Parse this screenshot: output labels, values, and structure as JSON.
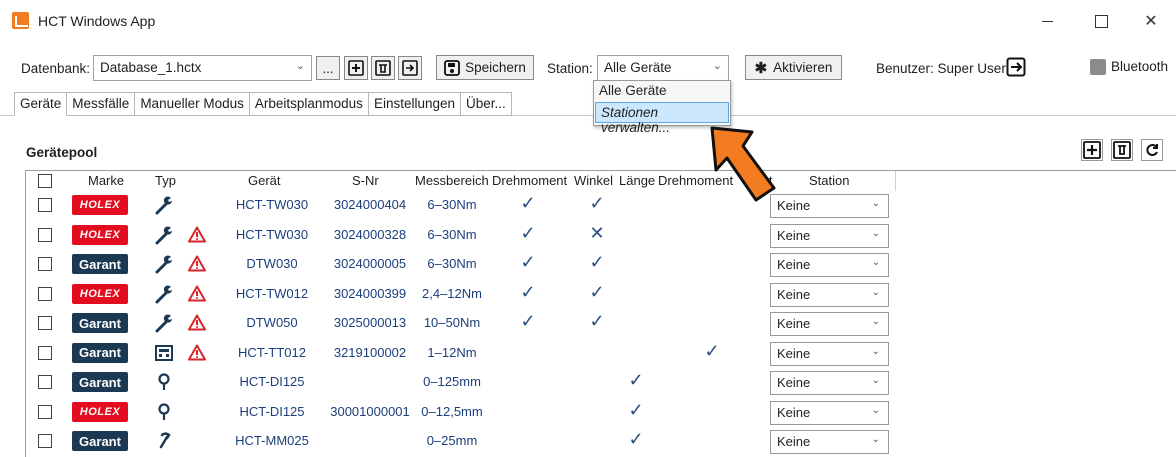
{
  "window": {
    "title": "HCT Windows App"
  },
  "toolbar": {
    "database_label": "Datenbank:",
    "database_value": "Database_1.hctx",
    "browse_label": "...",
    "save_label": "Speichern",
    "station_label": "Station:",
    "station_value": "Alle Geräte",
    "activate_label": "Aktivieren",
    "user_label": "Benutzer: Super User",
    "bluetooth_label": "Bluetooth"
  },
  "station_dropdown": {
    "options": [
      "Alle Geräte",
      "Stationen verwalten..."
    ],
    "highlighted": "Stationen verwalten..."
  },
  "tabs": [
    "Geräte",
    "Messfälle",
    "Manueller Modus",
    "Arbeitsplanmodus",
    "Einstellungen",
    "Über..."
  ],
  "pool": {
    "title": "Gerätepool"
  },
  "table": {
    "columns": [
      "Marke",
      "Typ",
      "Gerät",
      "S-Nr",
      "Messbereich",
      "Drehmoment",
      "Winkel",
      "Länge",
      "Drehmoment",
      "Station"
    ],
    "header_hidden_suffix": "...t",
    "rows": [
      {
        "brand": "HOLEX",
        "type_icon": "torque-wrench-icon",
        "warning": false,
        "device": "HCT-TW030",
        "serial": "3024000404",
        "range": "6–30Nm",
        "drehmoment": "check",
        "winkel": "check",
        "laenge": "",
        "drehmoment2": "",
        "station": "Keine"
      },
      {
        "brand": "HOLEX",
        "type_icon": "torque-wrench-icon",
        "warning": true,
        "device": "HCT-TW030",
        "serial": "3024000328",
        "range": "6–30Nm",
        "drehmoment": "check",
        "winkel": "cross",
        "laenge": "",
        "drehmoment2": "",
        "station": "Keine"
      },
      {
        "brand": "Garant",
        "type_icon": "torque-wrench-icon",
        "warning": true,
        "device": "DTW030",
        "serial": "3024000005",
        "range": "6–30Nm",
        "drehmoment": "check",
        "winkel": "check",
        "laenge": "",
        "drehmoment2": "",
        "station": "Keine"
      },
      {
        "brand": "HOLEX",
        "type_icon": "torque-wrench-icon",
        "warning": true,
        "device": "HCT-TW012",
        "serial": "3024000399",
        "range": "2,4–12Nm",
        "drehmoment": "check",
        "winkel": "check",
        "laenge": "",
        "drehmoment2": "",
        "station": "Keine"
      },
      {
        "brand": "Garant",
        "type_icon": "torque-wrench-icon",
        "warning": true,
        "device": "DTW050",
        "serial": "3025000013",
        "range": "10–50Nm",
        "drehmoment": "check",
        "winkel": "check",
        "laenge": "",
        "drehmoment2": "",
        "station": "Keine"
      },
      {
        "brand": "Garant",
        "type_icon": "torque-tester-icon",
        "warning": true,
        "device": "HCT-TT012",
        "serial": "3219100002",
        "range": "1–12Nm",
        "drehmoment": "",
        "winkel": "",
        "laenge": "",
        "drehmoment2": "check",
        "station": "Keine"
      },
      {
        "brand": "Garant",
        "type_icon": "dial-indicator-icon",
        "warning": false,
        "device": "HCT-DI125",
        "serial": "",
        "range": "0–125mm",
        "drehmoment": "",
        "winkel": "",
        "laenge": "check",
        "drehmoment2": "",
        "station": "Keine"
      },
      {
        "brand": "HOLEX",
        "type_icon": "dial-indicator-icon",
        "warning": false,
        "device": "HCT-DI125",
        "serial": "30001000001",
        "range": "0–12,5mm",
        "drehmoment": "",
        "winkel": "",
        "laenge": "check",
        "drehmoment2": "",
        "station": "Keine"
      },
      {
        "brand": "Garant",
        "type_icon": "micrometer-icon",
        "warning": false,
        "device": "HCT-MM025",
        "serial": "",
        "range": "0–25mm",
        "drehmoment": "",
        "winkel": "",
        "laenge": "check",
        "drehmoment2": "",
        "station": "Keine"
      }
    ]
  },
  "colors": {
    "holex": "#e30d1f",
    "garant": "#1c3954",
    "link": "#1c3f7c",
    "warning": "#d6262b",
    "arrow": "#f47c20",
    "highlight": "#cce8ff"
  }
}
